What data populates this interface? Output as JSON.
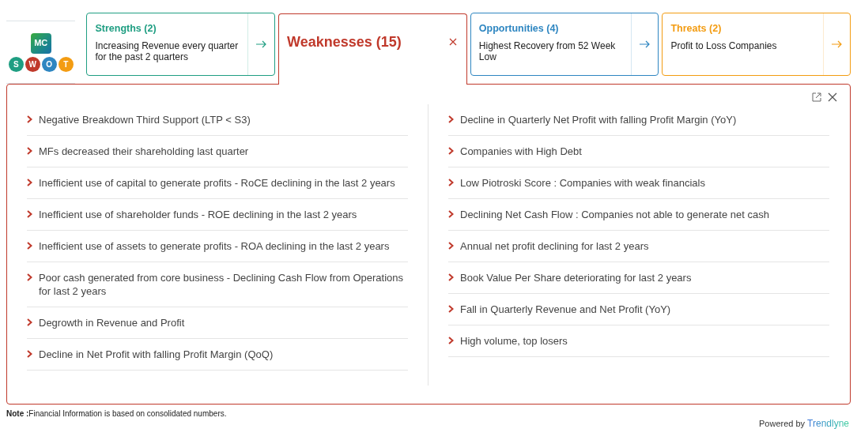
{
  "logo": {
    "badge": "MC",
    "letters": [
      {
        "text": "S",
        "color": "#1f9e82"
      },
      {
        "text": "W",
        "color": "#c0392b"
      },
      {
        "text": "O",
        "color": "#2e86c1"
      },
      {
        "text": "T",
        "color": "#f39c12"
      }
    ]
  },
  "cards": [
    {
      "title": "Strengths (2)",
      "description": "Increasing Revenue every quarter for the past 2 quarters",
      "color": "#1f9e82",
      "selected": false
    },
    {
      "title": "Weaknesses (15)",
      "color": "#c0392b",
      "selected": true
    },
    {
      "title": "Opportunities (4)",
      "description": "Highest Recovery from 52 Week Low",
      "color": "#2e86c1",
      "selected": false
    },
    {
      "title": "Threats (2)",
      "description": "Profit to Loss Companies",
      "color": "#f39c12",
      "selected": false
    }
  ],
  "columns": [
    [
      "Negative Breakdown Third Support (LTP < S3)",
      "MFs decreased their shareholding last quarter",
      "Inefficient use of capital to generate profits - RoCE declining in the last 2 years",
      "Inefficient use of shareholder funds - ROE declining in the last 2 years",
      "Inefficient use of assets to generate profits - ROA declining in the last 2 years",
      "Poor cash generated from core business - Declining Cash Flow from Operations for last 2 years",
      "Degrowth in Revenue and Profit",
      "Decline in Net Profit with falling Profit Margin (QoQ)"
    ],
    [
      "Decline in Quarterly Net Profit with falling Profit Margin (YoY)",
      "Companies with High Debt",
      "Low Piotroski Score : Companies with weak financials",
      "Declining Net Cash Flow : Companies not able to generate net cash",
      "Annual net profit declining for last 2 years",
      "Book Value Per Share deteriorating for last 2 years",
      "Fall in Quarterly Revenue and Net Profit (YoY)",
      "High volume, top losers"
    ]
  ],
  "note": "**Note :**Financial Information is based on consolidated numbers.",
  "powered_by": {
    "label": "Powered by",
    "brand": "Trendlyne"
  }
}
